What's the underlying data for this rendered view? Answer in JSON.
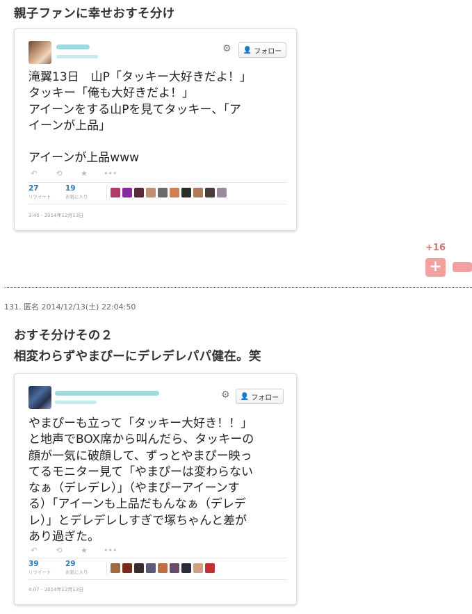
{
  "post1": {
    "heading": "親子ファンに幸せおすそ分け",
    "tweet": {
      "follow_label": "フォロー",
      "lines": [
        "滝翼13日　山P「タッキー大好きだよ！」",
        "タッキー「俺も大好きだよ！」",
        "アイーンをする山Pを見てタッキー、「ア",
        "イーンが上品」",
        "",
        "アイーンが上品www"
      ],
      "retweets": "27",
      "retweets_label": "リツイート",
      "favorites": "19",
      "favorites_label": "お気に入り",
      "date": "3:40 - 2014年12月13日",
      "avatar_colors": [
        "#b03a6a",
        "#8a2aa0",
        "#5a2a3a",
        "#c09070",
        "#6a6a6a",
        "#d08050",
        "#2a2a2a",
        "#b07a5a",
        "#4a3a3a",
        "#9a8aa0"
      ]
    }
  },
  "vote": {
    "count": "+16",
    "plus_label": "+"
  },
  "post2": {
    "meta": "131. 匿名 2014/12/13(土) 22:04:50",
    "heading_lines": [
      "おすそ分けその２",
      "相変わらずやまぴーにデレデレパパ健在。笑"
    ],
    "tweet": {
      "follow_label": "フォロー",
      "lines": [
        "やまぴーも立って「タッキー大好き！！」",
        "と地声でBOX席から叫んだら、タッキーの",
        "顔が一気に破顔して、ずっとやまぴー映っ",
        "てるモニター見て「やまぴーは変わらない",
        "なぁ（デレデレ）」（やまぴーアイーンす",
        "る）「アイーンも上品だもんなぁ（デレデ",
        "レ）」とデレデレしすぎで塚ちゃんと差が",
        "あり過ぎた。"
      ],
      "retweets": "39",
      "retweets_label": "リツイート",
      "favorites": "29",
      "favorites_label": "お気に入り",
      "date": "4:07 - 2014年12月13日",
      "avatar_colors": [
        "#a06a40",
        "#7a2a1a",
        "#3a2a2a",
        "#5a5a7a",
        "#c07040",
        "#6a4a6a",
        "#2a2a3a",
        "#d0a080",
        "#c03030"
      ]
    }
  }
}
